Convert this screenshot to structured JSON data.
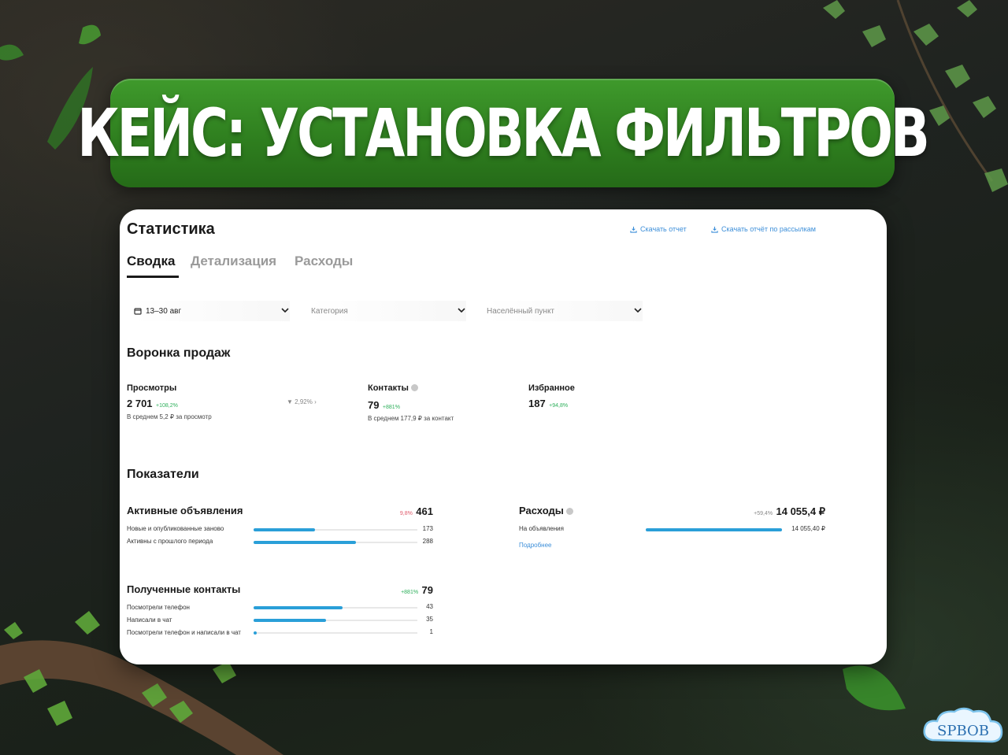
{
  "banner": {
    "title": "КЕЙС: УСТАНОВКА ФИЛЬТРОВ"
  },
  "stats": {
    "title": "Статистика",
    "downloads": {
      "report": "Скачать отчет",
      "mailing_report": "Скачать отчёт по рассылкам"
    },
    "tabs": [
      {
        "label": "Сводка",
        "active": true
      },
      {
        "label": "Детализация",
        "active": false
      },
      {
        "label": "Расходы",
        "active": false
      }
    ],
    "filters": {
      "date": {
        "value": "13–30 авг"
      },
      "category": {
        "placeholder": "Категория"
      },
      "city": {
        "placeholder": "Населённый пункт"
      }
    },
    "funnel": {
      "title": "Воронка продаж",
      "views": {
        "label": "Просмотры",
        "value": "2 701",
        "delta": "+108,2%",
        "sub": "В среднем 5,2 ₽ за просмотр",
        "conversion": "2,92%"
      },
      "contacts": {
        "label": "Контакты",
        "value": "79",
        "delta": "+881%",
        "sub": "В среднем 177,9 ₽ за контакт"
      },
      "favorites": {
        "label": "Избранное",
        "value": "187",
        "delta": "+94,8%"
      }
    },
    "indicators": {
      "title": "Показатели",
      "active_ads": {
        "title": "Активные объявления",
        "delta": "9,8%",
        "total": "461",
        "rows": [
          {
            "label": "Новые и опубликованные заново",
            "value": "173",
            "fraction": 0.375
          },
          {
            "label": "Активны с прошлого периода",
            "value": "288",
            "fraction": 0.625
          }
        ]
      },
      "expenses": {
        "title": "Расходы",
        "delta": "+59,4%",
        "total": "14 055,4 ₽",
        "rows": [
          {
            "label": "На объявления",
            "value": "14 055,40 ₽",
            "fraction": 1.0
          }
        ],
        "more_link": "Подробнее"
      },
      "received_contacts": {
        "title": "Полученные контакты",
        "delta": "+881%",
        "total": "79",
        "rows": [
          {
            "label": "Посмотрели телефон",
            "value": "43",
            "fraction": 0.544
          },
          {
            "label": "Написали в чат",
            "value": "35",
            "fraction": 0.443
          },
          {
            "label": "Посмотрели телефон и написали в чат",
            "value": "1",
            "fraction": 0.013
          }
        ]
      }
    }
  },
  "watermark": {
    "text": "SPBOB"
  },
  "colors": {
    "banner_green": "#2f7f1f",
    "bar_blue": "#2a9fd8",
    "positive": "#2fb05c",
    "negative": "#e05a6b",
    "link": "#3d8fd9"
  }
}
